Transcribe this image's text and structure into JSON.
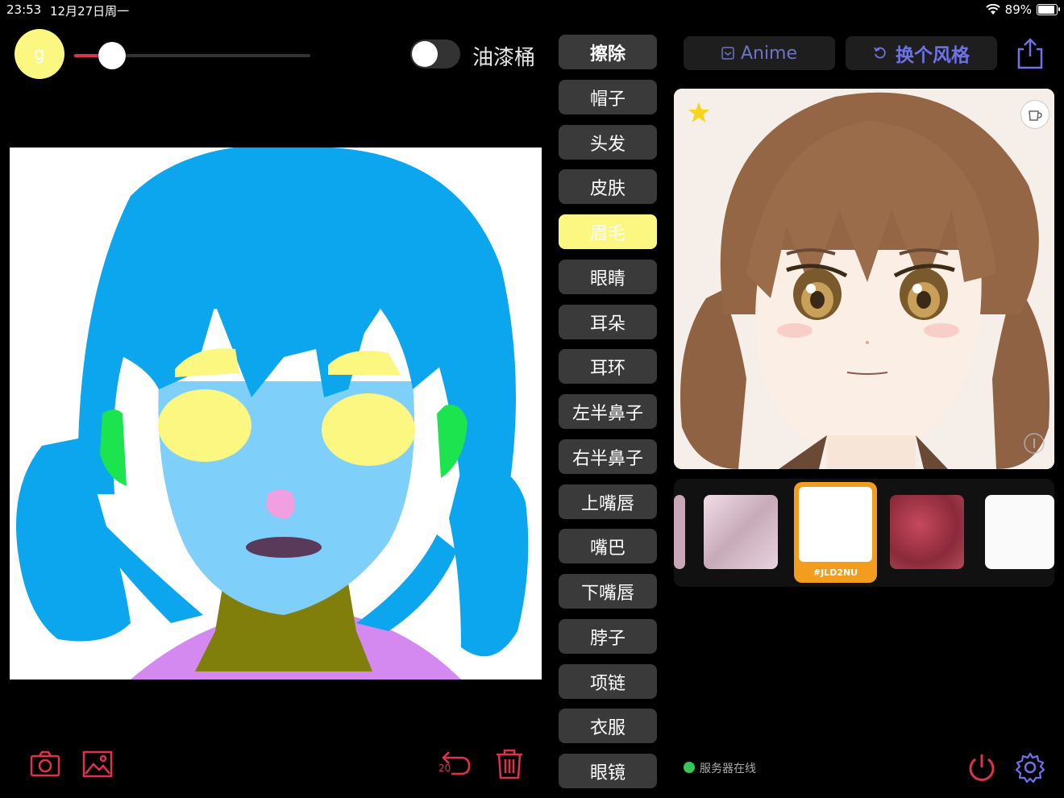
{
  "status_bar": {
    "time": "23:53",
    "date": "12月27日周一",
    "battery": "89%"
  },
  "toolbar": {
    "brush_letter": "g",
    "bucket_label": "油漆桶",
    "brush_size": 0.16
  },
  "labels": [
    {
      "label": "擦除",
      "active": false
    },
    {
      "label": "帽子",
      "active": false
    },
    {
      "label": "头发",
      "active": false
    },
    {
      "label": "皮肤",
      "active": false
    },
    {
      "label": "眉毛",
      "active": true
    },
    {
      "label": "眼睛",
      "active": false
    },
    {
      "label": "耳朵",
      "active": false
    },
    {
      "label": "耳环",
      "active": false
    },
    {
      "label": "左半鼻子",
      "active": false
    },
    {
      "label": "右半鼻子",
      "active": false
    },
    {
      "label": "上嘴唇",
      "active": false
    },
    {
      "label": "嘴巴",
      "active": false
    },
    {
      "label": "下嘴唇",
      "active": false
    },
    {
      "label": "脖子",
      "active": false
    },
    {
      "label": "项链",
      "active": false
    },
    {
      "label": "衣服",
      "active": false
    },
    {
      "label": "眼镜",
      "active": false
    }
  ],
  "style": {
    "current": "Anime",
    "change_label": "换个风格"
  },
  "thumbnails": {
    "selected_code": "#JLD2NU"
  },
  "bottom": {
    "undo_count": "20",
    "server_status": "服务器在线"
  },
  "colors": {
    "accent_red": "#e0324d",
    "active_yellow": "#fbf781",
    "style_blue": "#6f73e8",
    "online_green": "#34c759"
  },
  "icons": [
    "camera-icon",
    "image-icon",
    "undo-icon",
    "trash-icon",
    "share-icon",
    "star-icon",
    "cup-icon",
    "power-icon",
    "gear-icon"
  ]
}
